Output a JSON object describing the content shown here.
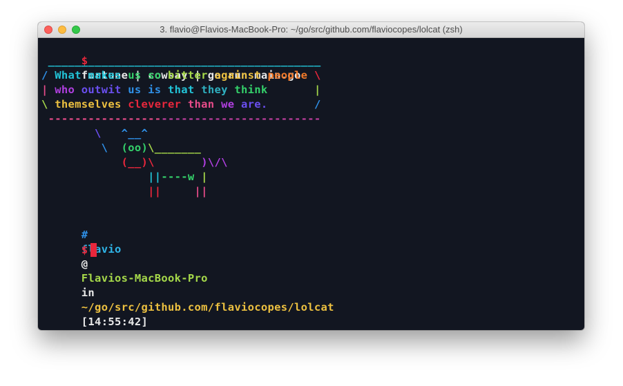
{
  "window": {
    "title": "3. flavio@Flavios-MacBook-Pro: ~/go/src/github.com/flaviocopes/lolcat (zsh)"
  },
  "colors": {
    "background": "#121621",
    "titlebar": "#dcdcdc",
    "cursor": "#e8273c",
    "prompt_dollar": "#e8273c",
    "prompt_hash": "#2f8fe6",
    "prompt_user": "#2fb5e8",
    "prompt_host": "#a6d94a",
    "prompt_path": "#ecc040",
    "rainbow": [
      "#e8273c",
      "#e84c8a",
      "#b03fe0",
      "#6a4ff0",
      "#2f8fe6",
      "#22c4d8",
      "#34d06a",
      "#a6d94a",
      "#ecc040",
      "#f27a2a"
    ]
  },
  "terminal": {
    "command": {
      "prompt": "$",
      "text": "fortune | cowsay | go run main.go"
    },
    "output": [
      [
        {
          "t": " ",
          "c": "#121621"
        },
        {
          "t": "_________________________________________",
          "c": "#22c4d8"
        }
      ],
      [
        {
          "t": "/ ",
          "c": "#2f8fe6"
        },
        {
          "t": "What makes ",
          "c": "#22c4d8"
        },
        {
          "t": "us so ",
          "c": "#34d06a"
        },
        {
          "t": "bitter ",
          "c": "#a6d94a"
        },
        {
          "t": "against ",
          "c": "#ecc040"
        },
        {
          "t": "people ",
          "c": "#f27a2a"
        },
        {
          "t": "\\",
          "c": "#e8273c"
        }
      ],
      [
        {
          "t": "| ",
          "c": "#e84c8a"
        },
        {
          "t": "who ",
          "c": "#b03fe0"
        },
        {
          "t": "outwit ",
          "c": "#6a4ff0"
        },
        {
          "t": "us is ",
          "c": "#2f8fe6"
        },
        {
          "t": "that ",
          "c": "#22c4d8"
        },
        {
          "t": "they ",
          "c": "#2fb0c0"
        },
        {
          "t": "think",
          "c": "#34d06a"
        },
        {
          "t": "       |",
          "c": "#a6d94a"
        }
      ],
      [
        {
          "t": "\\ ",
          "c": "#a6d94a"
        },
        {
          "t": "themselves ",
          "c": "#ecc040"
        },
        {
          "t": "cleverer ",
          "c": "#e8273c"
        },
        {
          "t": "than ",
          "c": "#e84c8a"
        },
        {
          "t": "we ",
          "c": "#b03fe0"
        },
        {
          "t": "are.",
          "c": "#6a4ff0"
        },
        {
          "t": "       /",
          "c": "#2f8fe6"
        }
      ],
      [
        {
          "t": " -----------------",
          "c": "#e84c8a"
        },
        {
          "t": "------------------------",
          "c": "#c03fa0"
        }
      ],
      [
        {
          "t": "        \\   ",
          "c": "#6a4ff0"
        },
        {
          "t": "^__^",
          "c": "#2f8fe6"
        }
      ],
      [
        {
          "t": "         \\  ",
          "c": "#2f8fe6"
        },
        {
          "t": "(oo)",
          "c": "#34d06a"
        },
        {
          "t": "\\_______",
          "c": "#a6d94a"
        }
      ],
      [
        {
          "t": "            ",
          "c": "#121621"
        },
        {
          "t": "(__)\\",
          "c": "#e8273c"
        },
        {
          "t": "       ",
          "c": "#121621"
        },
        {
          "t": ")\\/\\",
          "c": "#b03fe0"
        }
      ],
      [
        {
          "t": "                ",
          "c": "#121621"
        },
        {
          "t": "||",
          "c": "#22c4d8"
        },
        {
          "t": "----w ",
          "c": "#34d06a"
        },
        {
          "t": "|",
          "c": "#a6d94a"
        }
      ],
      [
        {
          "t": "                ",
          "c": "#121621"
        },
        {
          "t": "||",
          "c": "#e8273c"
        },
        {
          "t": "     ",
          "c": "#121621"
        },
        {
          "t": "||",
          "c": "#e84c8a"
        }
      ]
    ],
    "status": {
      "hash": "#",
      "user": "flavio",
      "at": "@",
      "host": "Flavios-MacBook-Pro",
      "in": "in",
      "path": "~/go/src/github.com/flaviocopes/lolcat",
      "time": "[14:55:42]"
    },
    "input_prompt": "$"
  }
}
